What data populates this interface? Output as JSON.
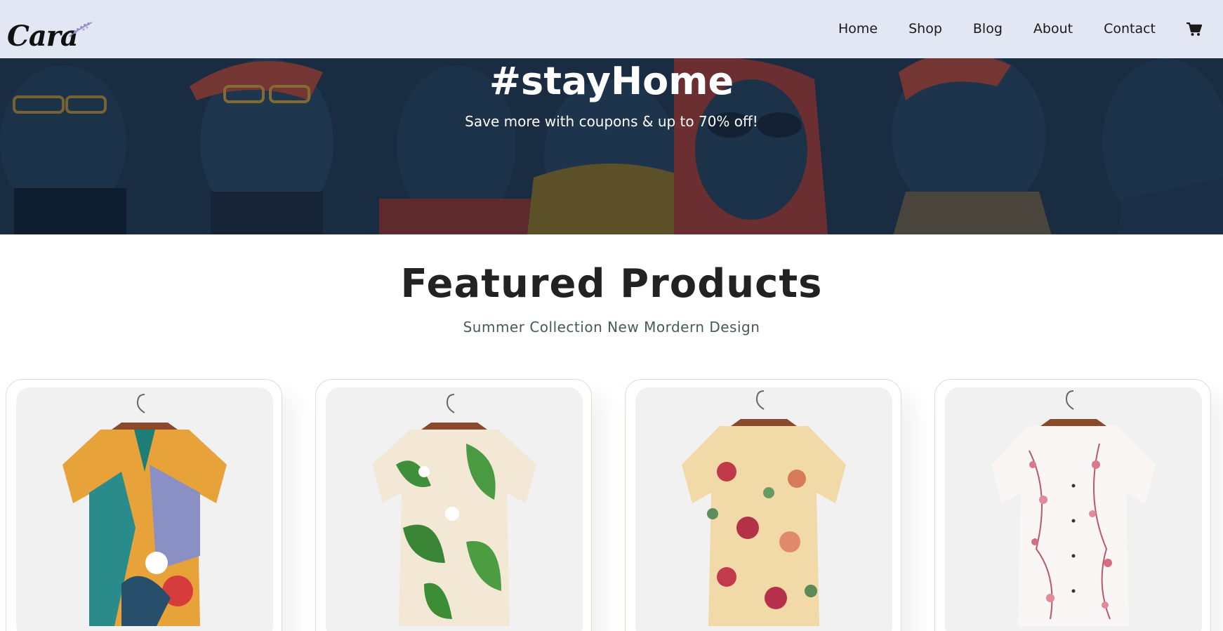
{
  "brand": {
    "logo_text": "Cara"
  },
  "nav": {
    "items": [
      {
        "label": "Home"
      },
      {
        "label": "Shop"
      },
      {
        "label": "Blog"
      },
      {
        "label": "About"
      },
      {
        "label": "Contact"
      }
    ],
    "cart_icon": "shopping-cart-icon"
  },
  "hero": {
    "title": "#stayHome",
    "subtitle": "Save more with coupons & up to 70% off!"
  },
  "featured": {
    "title": "Featured Products",
    "subtitle": "Summer Collection New Mordern Design"
  },
  "products": [
    {
      "image": "multicolor-abstract-print-shirt"
    },
    {
      "image": "green-leaf-floral-shirt"
    },
    {
      "image": "rose-floral-cream-shirt"
    },
    {
      "image": "pink-blossom-white-shirt"
    }
  ],
  "colors": {
    "header_bg": "#e3e6f3",
    "card_border": "#cce7d0",
    "hero_bg": "#1d2f45"
  }
}
